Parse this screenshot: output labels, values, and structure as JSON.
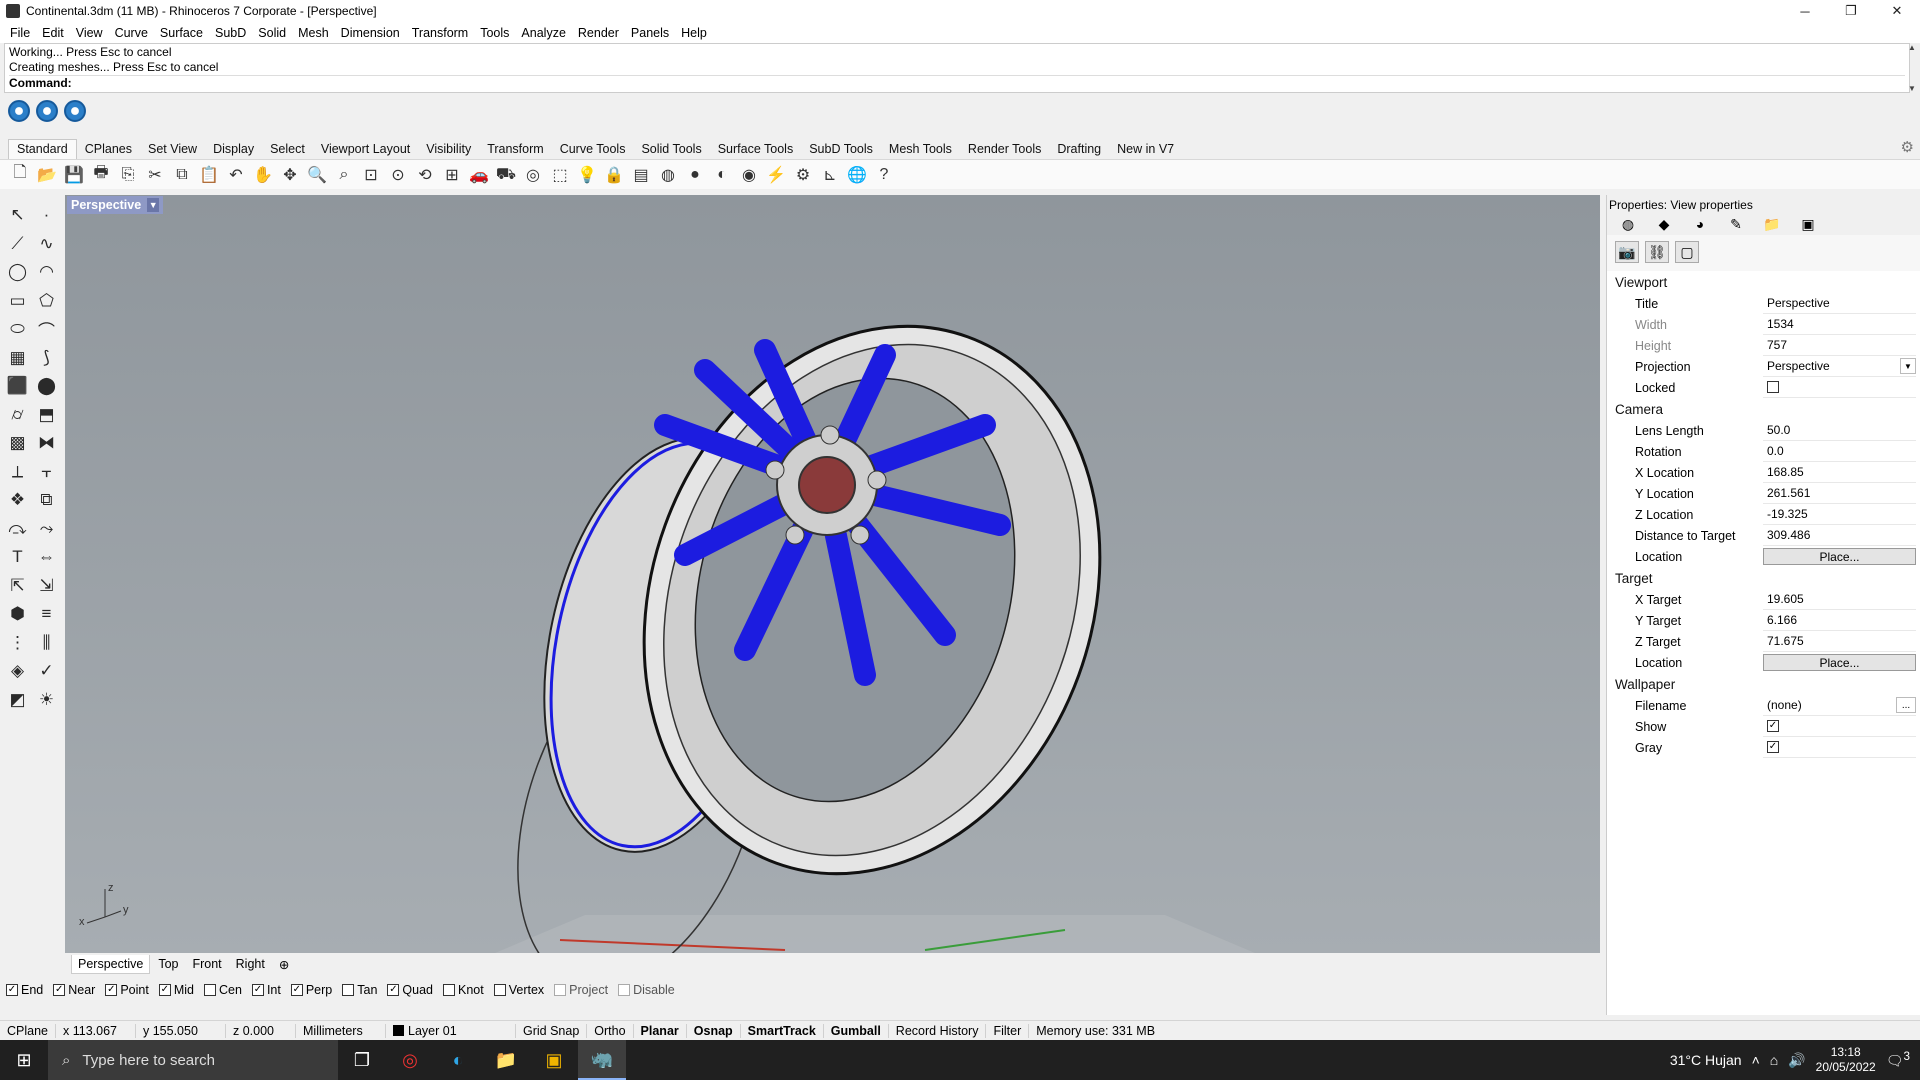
{
  "window": {
    "title": "Continental.3dm (11 MB) - Rhinoceros 7 Corporate - [Perspective]"
  },
  "menu": [
    "File",
    "Edit",
    "View",
    "Curve",
    "Surface",
    "SubD",
    "Solid",
    "Mesh",
    "Dimension",
    "Transform",
    "Tools",
    "Analyze",
    "Render",
    "Panels",
    "Help"
  ],
  "command": {
    "history": [
      "Working... Press Esc to cancel",
      "Creating meshes... Press Esc to cancel"
    ],
    "prompt": "Command:"
  },
  "toolbar_tabs": [
    "Standard",
    "CPlanes",
    "Set View",
    "Display",
    "Select",
    "Viewport Layout",
    "Visibility",
    "Transform",
    "Curve Tools",
    "Solid Tools",
    "Surface Tools",
    "SubD Tools",
    "Mesh Tools",
    "Render Tools",
    "Drafting",
    "New in V7"
  ],
  "viewport": {
    "title": "Perspective",
    "axis_x": "x",
    "axis_y": "y",
    "axis_z": "z"
  },
  "viewport_tabs": [
    "Perspective",
    "Top",
    "Front",
    "Right"
  ],
  "osnaps": [
    {
      "label": "End",
      "checked": true
    },
    {
      "label": "Near",
      "checked": true
    },
    {
      "label": "Point",
      "checked": true
    },
    {
      "label": "Mid",
      "checked": true
    },
    {
      "label": "Cen",
      "checked": false
    },
    {
      "label": "Int",
      "checked": true
    },
    {
      "label": "Perp",
      "checked": true
    },
    {
      "label": "Tan",
      "checked": false
    },
    {
      "label": "Quad",
      "checked": true
    },
    {
      "label": "Knot",
      "checked": false
    },
    {
      "label": "Vertex",
      "checked": false
    },
    {
      "label": "Project",
      "checked": false
    },
    {
      "label": "Disable",
      "checked": false
    }
  ],
  "status": {
    "cplane": "CPlane",
    "x": "x 113.067",
    "y": "y 155.050",
    "z": "z 0.000",
    "units": "Millimeters",
    "layer": "Layer 01",
    "grid_snap": "Grid Snap",
    "ortho": "Ortho",
    "planar": "Planar",
    "osnap": "Osnap",
    "smarttrack": "SmartTrack",
    "gumball": "Gumball",
    "record_history": "Record History",
    "filter": "Filter",
    "memory": "Memory use: 331 MB"
  },
  "properties": {
    "title": "Properties: View properties",
    "viewport_header": "Viewport",
    "viewport_rows": [
      {
        "label": "Title",
        "value": "Perspective"
      },
      {
        "label": "Width",
        "value": "1534"
      },
      {
        "label": "Height",
        "value": "757"
      },
      {
        "label": "Projection",
        "value": "Perspective"
      },
      {
        "label": "Locked",
        "value": ""
      }
    ],
    "camera_header": "Camera",
    "camera_rows": [
      {
        "label": "Lens Length",
        "value": "50.0"
      },
      {
        "label": "Rotation",
        "value": "0.0"
      },
      {
        "label": "X Location",
        "value": "168.85"
      },
      {
        "label": "Y Location",
        "value": "261.561"
      },
      {
        "label": "Z Location",
        "value": "-19.325"
      },
      {
        "label": "Distance to Target",
        "value": "309.486"
      },
      {
        "label": "Location",
        "value": "Place..."
      }
    ],
    "target_header": "Target",
    "target_rows": [
      {
        "label": "X Target",
        "value": "19.605"
      },
      {
        "label": "Y Target",
        "value": "6.166"
      },
      {
        "label": "Z Target",
        "value": "71.675"
      },
      {
        "label": "Location",
        "value": "Place..."
      }
    ],
    "wallpaper_header": "Wallpaper",
    "wallpaper_rows": [
      {
        "label": "Filename",
        "value": "(none)"
      },
      {
        "label": "Show",
        "value": ""
      },
      {
        "label": "Gray",
        "value": ""
      }
    ]
  },
  "taskbar": {
    "search_placeholder": "Type here to search",
    "weather": "31°C Hujan",
    "time": "13:18",
    "date": "20/05/2022",
    "notifications": "3"
  },
  "colors": {
    "spokes": "#1c1ce0",
    "viewport_bg": "#9aa1a7",
    "title_active": "#8e99c5"
  }
}
